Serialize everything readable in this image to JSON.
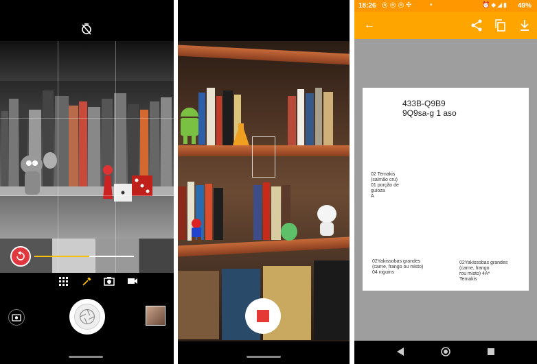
{
  "camera": {
    "timer_icon": "timer-off-icon",
    "mode_icons": [
      "grid-icon",
      "eyedropper-icon",
      "camera-icon",
      "video-icon"
    ],
    "flip_icon": "camera-flip-icon",
    "slider_level": 0.55
  },
  "video": {
    "stop_icon": "stop-icon"
  },
  "document": {
    "status": {
      "time": "18:26",
      "battery": "49%"
    },
    "appbar": {
      "back_icon": "back-arrow-icon",
      "share_icon": "share-icon",
      "copy_icon": "copy-icon",
      "download_icon": "download-icon"
    },
    "page": {
      "title_line1": "433B-Q9B9",
      "title_line2": "9Q9sa-g 1 aso",
      "block1": [
        "02 Temakis",
        "(salmão cru)",
        "01 porção de",
        "guioza",
        "A"
      ],
      "block2": [
        "02Yakissobas grandes",
        "(carne, frango ou misto)",
        "04 niguins"
      ],
      "block3": [
        "02Yakissobas grandes",
        "(carne, frango",
        "rou misto) 4A*",
        "Temakis"
      ]
    },
    "colors": {
      "accent": "#ffa500",
      "status": "#ff9800"
    }
  }
}
